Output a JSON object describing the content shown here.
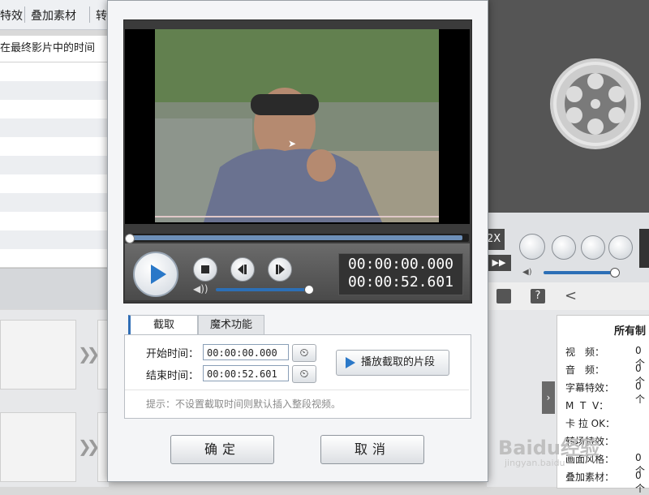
{
  "background_app": {
    "tabs": [
      "特效",
      "叠加素材",
      "转"
    ],
    "column_header": "在最终影片中的时间",
    "right_panel": {
      "title": "所有制",
      "rows": [
        {
          "label": "视　频：",
          "value": "0个"
        },
        {
          "label": "音　频：",
          "value": "0个"
        },
        {
          "label": "字幕特效：",
          "value": "0个"
        },
        {
          "label": "M  T  V：",
          "value": ""
        },
        {
          "label": "卡 拉 OK：",
          "value": ""
        },
        {
          "label": "转场特效：",
          "value": ""
        },
        {
          "label": "画面风格：",
          "value": "0个"
        },
        {
          "label": "叠加素材：",
          "value": "0个"
        }
      ]
    },
    "speed_label": "2X",
    "watermark": "Baidu经验",
    "watermark_url": "jingyan.baidu"
  },
  "dialog": {
    "player": {
      "current_time": "00:00:00.000",
      "total_time": "00:00:52.601",
      "progress_fraction": 0.0,
      "volume_fraction": 0.95
    },
    "tabs": [
      {
        "label": "截取",
        "active": true
      },
      {
        "label": "魔术功能",
        "active": false
      }
    ],
    "start_label": "开始时间：",
    "start_value": "00:00:00.000",
    "end_label": "结束时间：",
    "end_value": "00:00:52.601",
    "play_segment_label": "播放截取的片段",
    "hint": "提示：不设置截取时间则默认插入整段视频。",
    "ok_label": "确定",
    "cancel_label": "取消"
  },
  "colors": {
    "accent": "#2f6db5",
    "dialog_bg": "#f4f5f7",
    "player_bg": "#3b3b3b"
  }
}
